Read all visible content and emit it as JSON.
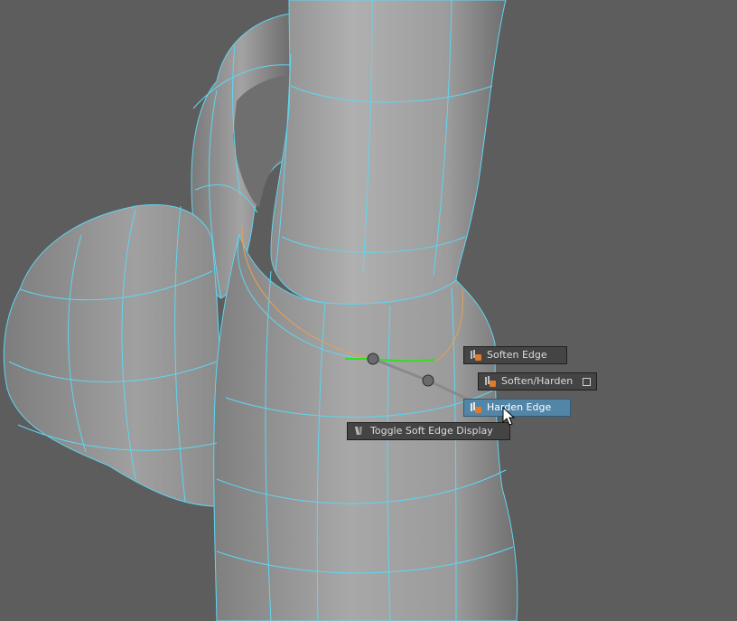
{
  "app": {
    "name": "3D viewport - marking menu"
  },
  "colors": {
    "background": "#5d5d5d",
    "wireframe": "#5fd6f0",
    "selected_edge": "#33dd22",
    "edge_loop_highlight": "#e8a14e",
    "menu_bg": "#444444",
    "menu_active_bg": "#5285a6",
    "menu_text": "#dcdcdc"
  },
  "marking_menu": {
    "items": [
      {
        "label": "Soften Edge",
        "icon": "soften-edge-icon",
        "active": false
      },
      {
        "label": "Soften/Harden",
        "icon": "soften-harden-icon",
        "active": false,
        "has_option_box": true
      },
      {
        "label": "Harden Edge",
        "icon": "harden-edge-icon",
        "active": true
      },
      {
        "label": "Toggle Soft Edge Display",
        "icon": "toggle-soft-edge-icon",
        "active": false
      }
    ]
  }
}
